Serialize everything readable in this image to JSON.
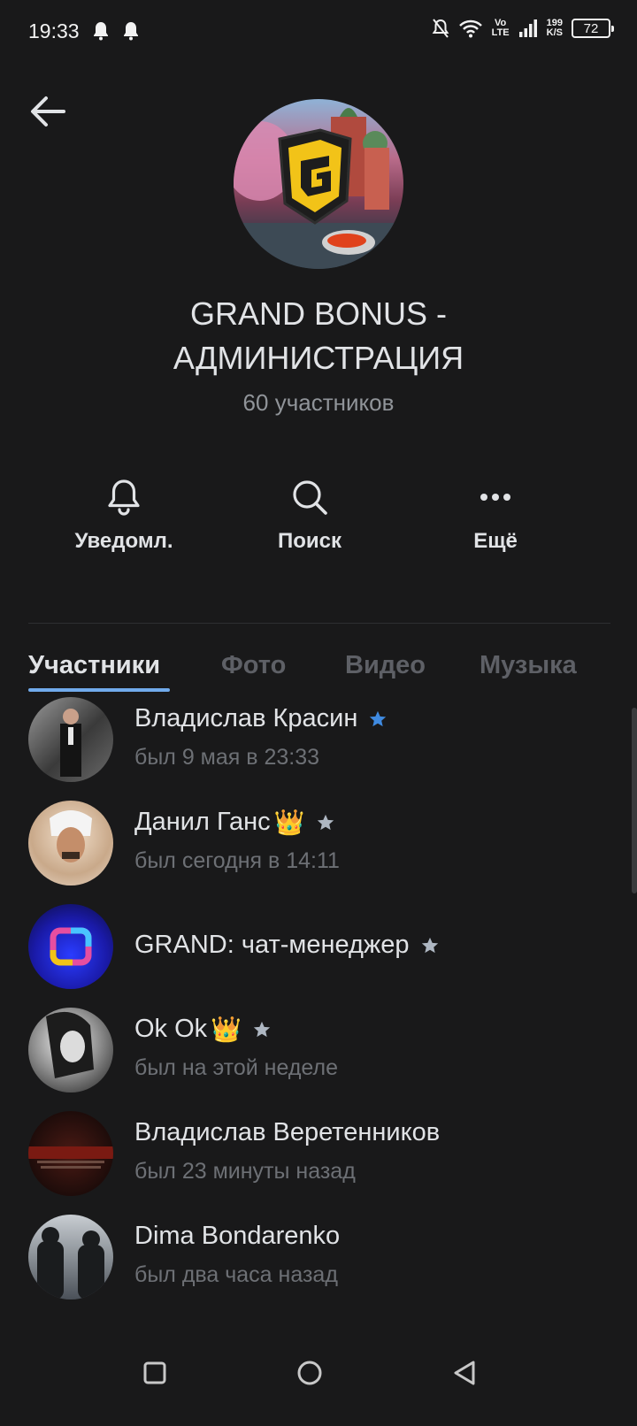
{
  "status_bar": {
    "time": "19:33",
    "vo_lte": "Vo\nLTE",
    "speed": "199\nK/S",
    "battery": "72"
  },
  "header": {
    "title": "GRAND BONUS - АДМИНИСТРАЦИЯ",
    "subtitle": "60 участников"
  },
  "actions": {
    "notifications": "Уведомл.",
    "search": "Поиск",
    "more": "Ещё"
  },
  "tabs": [
    {
      "label": "Участники",
      "active": true
    },
    {
      "label": "Фото",
      "active": false
    },
    {
      "label": "Видео",
      "active": false
    },
    {
      "label": "Музыка",
      "active": false
    }
  ],
  "members": [
    {
      "name": "Владислав Красин",
      "status": "был 9 мая в 23:33",
      "star_color": "#3f8ae0"
    },
    {
      "name": "Данил Ганс",
      "emoji": "👑",
      "status": "был сегодня в 14:11",
      "star_color": "#aeb7c2"
    },
    {
      "name": "GRAND: чат-менеджер",
      "status": "",
      "star_color": "#aeb7c2"
    },
    {
      "name": "Ok Ok",
      "emoji": "👑",
      "status": "был на этой неделе",
      "star_color": "#aeb7c2"
    },
    {
      "name": "Владислав Веретенников",
      "status": "был 23 минуты назад"
    },
    {
      "name": "Dima Bondarenko",
      "status": "был два часа назад"
    }
  ],
  "colors": {
    "background": "#19191a",
    "accent": "#71aaeb",
    "text_primary": "#e1e3e6",
    "text_secondary": "#909499"
  }
}
